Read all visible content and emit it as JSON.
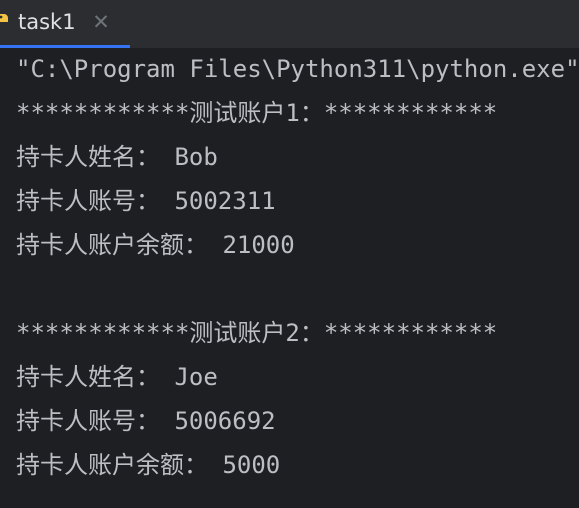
{
  "tab": {
    "label": "task1",
    "close_glyph": "✕",
    "icon": "python-file-icon"
  },
  "console": {
    "lines": [
      "\"C:\\Program Files\\Python311\\python.exe\"",
      "************测试账户1：************",
      "持卡人姓名： Bob",
      "持卡人账号： 5002311",
      "持卡人账户余额： 21000",
      "",
      "************测试账户2：************",
      "持卡人姓名： Joe",
      "持卡人账号： 5006692",
      "持卡人账户余额： 5000"
    ]
  },
  "colors": {
    "background": "#1e1f22",
    "tabbar": "#2b2d30",
    "text": "#bcbec4",
    "tab_underline": "#3574f0"
  }
}
